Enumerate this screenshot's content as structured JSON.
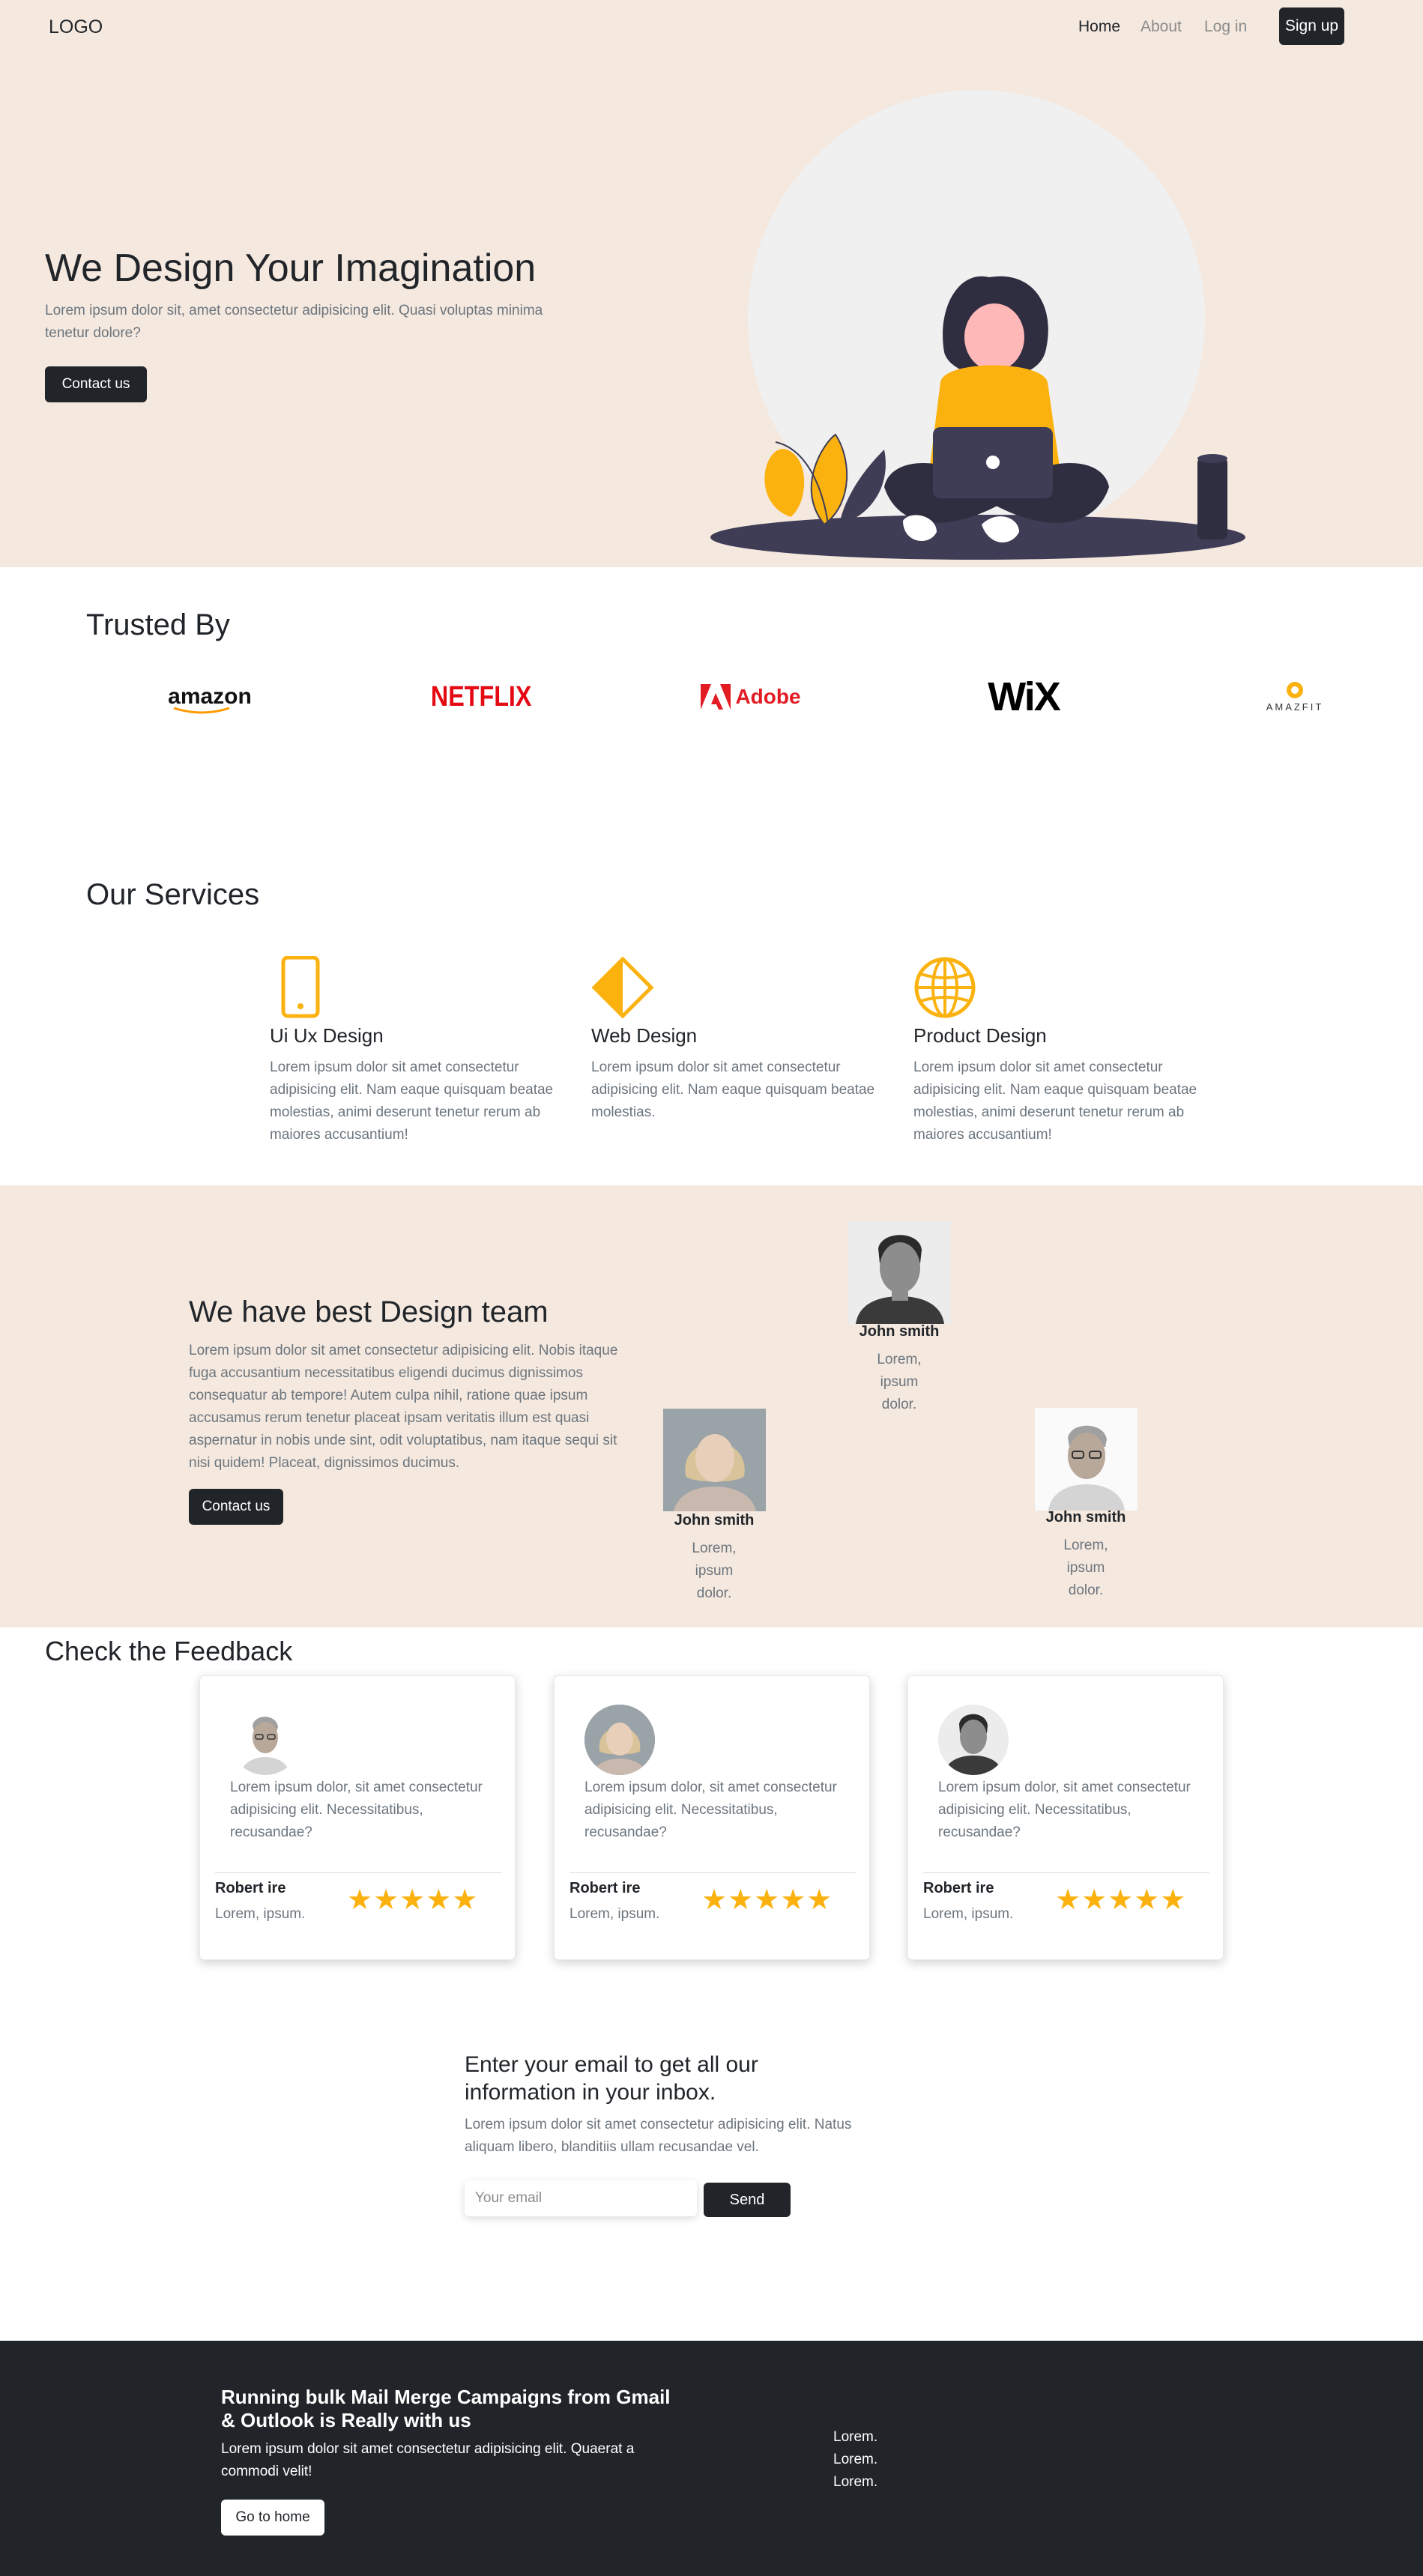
{
  "nav": {
    "logo": "LOGO",
    "links": [
      "Home",
      "About",
      "Log in"
    ],
    "signup": "Sign up"
  },
  "hero": {
    "title": "We Design Your Imagination",
    "subtitle": "Lorem ipsum dolor sit, amet consectetur adipisicing elit. Quasi voluptas minima tenetur dolore?",
    "button": "Contact us"
  },
  "trusted": {
    "title": "Trusted By",
    "brands": [
      "amazon",
      "NETFLIX",
      "Adobe",
      "WiX",
      "AMAZFIT"
    ]
  },
  "services": {
    "title": "Our Services",
    "items": [
      {
        "title": "Ui Ux Design",
        "text": "Lorem ipsum dolor sit amet consectetur adipisicing elit. Nam eaque quisquam beatae molestias, animi deserunt tenetur rerum ab maiores accusantium!",
        "icon": "phone-icon"
      },
      {
        "title": "Web Design",
        "text": "Lorem ipsum dolor sit amet consectetur adipisicing elit. Nam eaque quisquam beatae molestias.",
        "icon": "diamond-icon"
      },
      {
        "title": "Product Design",
        "text": "Lorem ipsum dolor sit amet consectetur adipisicing elit. Nam eaque quisquam beatae molestias, animi deserunt tenetur rerum ab maiores accusantium!",
        "icon": "globe-icon"
      }
    ]
  },
  "team": {
    "title": "We have best Design team",
    "text": "Lorem ipsum dolor sit amet consectetur adipisicing elit. Nobis itaque fuga accusantium necessitatibus eligendi ducimus dignissimos consequatur ab tempore! Autem culpa nihil, ratione quae ipsum accusamus rerum tenetur placeat ipsam veritatis illum est quasi aspernatur in nobis unde sint, odit voluptatibus, nam itaque sequi sit nisi quidem! Placeat, dignissimos ducimus.",
    "button": "Contact us",
    "members": [
      {
        "name": "John smith",
        "role": "Lorem, ipsum dolor."
      },
      {
        "name": "John smith",
        "role": "Lorem, ipsum dolor."
      },
      {
        "name": "John smith",
        "role": "Lorem, ipsum dolor."
      }
    ]
  },
  "feedback": {
    "title": "Check the Feedback",
    "cards": [
      {
        "quote": "Lorem ipsum dolor, sit amet consectetur adipisicing elit. Necessitatibus, recusandae?",
        "name": "Robert ire",
        "sub": "Lorem, ipsum.",
        "stars": "★★★★★",
        "rating": 5
      },
      {
        "quote": "Lorem ipsum dolor, sit amet consectetur adipisicing elit. Necessitatibus, recusandae?",
        "name": "Robert ire",
        "sub": "Lorem, ipsum.",
        "stars": "★★★★★",
        "rating": 5
      },
      {
        "quote": "Lorem ipsum dolor, sit amet consectetur adipisicing elit. Necessitatibus, recusandae?",
        "name": "Robert ire",
        "sub": "Lorem, ipsum.",
        "stars": "★★★★★",
        "rating": 5
      }
    ]
  },
  "newsletter": {
    "title": "Enter your email to get all our information in your inbox.",
    "text": "Lorem ipsum dolor sit amet consectetur adipisicing elit. Natus aliquam libero, blanditiis ullam recusandae vel.",
    "placeholder": "Your email",
    "button": "Send"
  },
  "footer": {
    "title": "Running bulk Mail Merge Campaigns from Gmail & Outlook is Really with us",
    "text": "Lorem ipsum dolor sit amet consectetur adipisicing elit. Quaerat a commodi velit!",
    "button": "Go to home",
    "links": [
      "Lorem.",
      "Lorem.",
      "Lorem."
    ]
  },
  "colors": {
    "accent": "#fbb20f",
    "hero_bg": "#f4e8df",
    "dark": "#212529",
    "netflix": "#e50914",
    "adobe": "#e31b23"
  }
}
